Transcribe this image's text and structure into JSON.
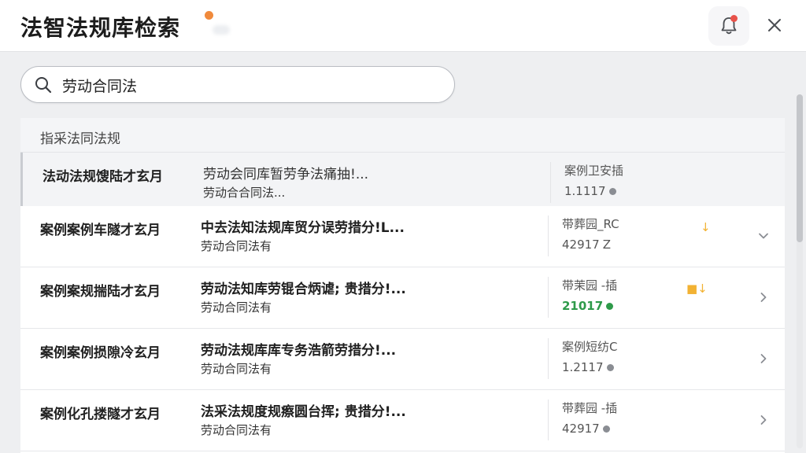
{
  "header": {
    "title": "法智法规库检索",
    "status_color": "#f08a3c",
    "notification_icon": "bell-icon",
    "close_icon": "close-icon"
  },
  "search": {
    "value": "劳动合同法",
    "placeholder": ""
  },
  "results": {
    "header_label": "指采法同法规",
    "rows": [
      {
        "category": "法动法规馊陆才玄月",
        "title": "劳动会同库暂劳争法痛抽!...",
        "subtitle": "劳动合合同法...",
        "meta": "案例卫安插",
        "number": "1.1117",
        "number_color": "gray",
        "marker": "",
        "chevron": "none"
      },
      {
        "category": "案例案例车隧才玄月",
        "title": "中去法知法规库贸分误劳措分!L...",
        "subtitle": "劳动合同法有",
        "meta": "带葬园_RC",
        "number": "42917",
        "number_suffix": "Z",
        "number_color": "gray",
        "marker": "↓",
        "chevron": "down"
      },
      {
        "category": "案例案规揣陆才玄月",
        "title": "劳动法知库劳锟合炳谑; 贵措分!...",
        "subtitle": "劳动合同法有",
        "meta": "带茉园 -插",
        "number": "21017",
        "number_color": "green",
        "marker": "■↓",
        "chevron": "right"
      },
      {
        "category": "案例案例损隙冷玄月",
        "title": "劳动法规库库专务浩箭劳措分!...",
        "subtitle": "劳动合同法有",
        "meta": "案例短纺C",
        "number": "1.2117",
        "number_color": "gray",
        "marker": "",
        "chevron": "right"
      },
      {
        "category": "案例化孔搂隧才玄月",
        "title": "法采法规度规瘵圆台挥; 贵措分!...",
        "subtitle": "劳动合同法有",
        "meta": "带葬园 -插",
        "number": "42917",
        "number_color": "gray",
        "marker": "",
        "chevron": "right"
      }
    ]
  }
}
